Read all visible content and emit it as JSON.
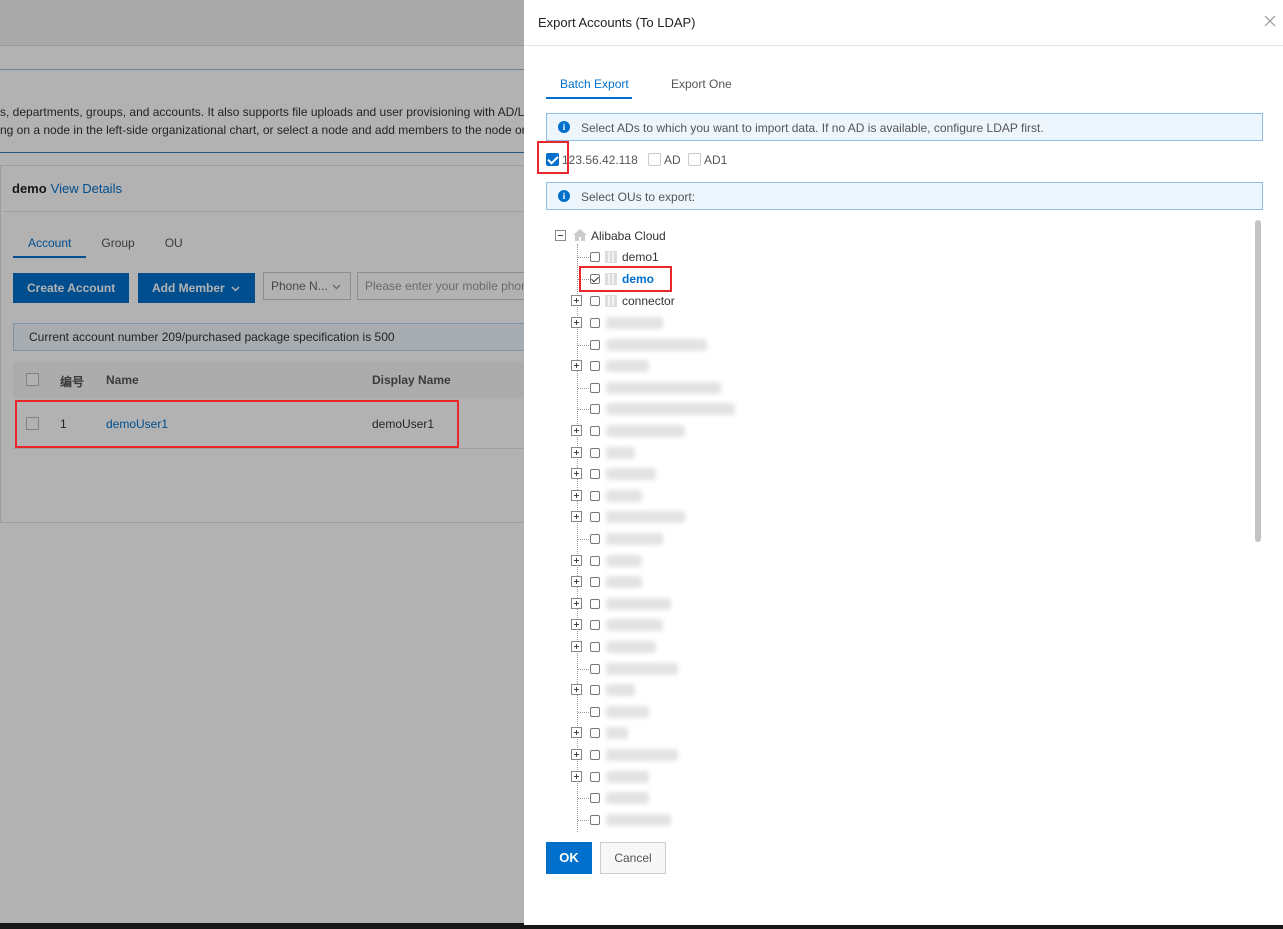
{
  "background": {
    "description_lines": [
      "s, departments, groups, and accounts. It also supports file uploads and user provisioning with AD/LD",
      "ng on a node in the left-side organizational chart, or select a node and add members to the node or"
    ],
    "node_name": "demo",
    "view_details_label": "View Details",
    "tabs": [
      "Account",
      "Group",
      "OU"
    ],
    "create_account_label": "Create Account",
    "add_member_label": "Add Member",
    "phone_select_value": "Phone N...",
    "search_placeholder": "Please enter your mobile phon",
    "account_note": "Current account number 209/purchased package specification is 500",
    "table": {
      "headers": [
        "编号",
        "Name",
        "Display Name"
      ],
      "rows": [
        {
          "id": "1",
          "name": "demoUser1",
          "display_name": "demoUser1"
        }
      ]
    }
  },
  "modal": {
    "title": "Export Accounts (To LDAP)",
    "tabs": [
      "Batch Export",
      "Export One"
    ],
    "active_tab": "Batch Export",
    "ad_note": "Select ADs to which you want to import data. If no AD is available, configure LDAP first.",
    "ad_options": [
      {
        "label": "123.56.42.118",
        "checked": true
      },
      {
        "label": "AD",
        "checked": false
      },
      {
        "label": "AD1",
        "checked": false
      }
    ],
    "ou_note": "Select OUs to export:",
    "tree": {
      "root_label": "Alibaba Cloud",
      "children": [
        {
          "label": "demo1",
          "expandable": false,
          "checked": false
        },
        {
          "label": "demo",
          "expandable": false,
          "checked": true,
          "selected": true
        },
        {
          "label": "connector",
          "expandable": true,
          "checked": false
        }
      ],
      "obscured_rows": [
        {
          "expandable": true,
          "blur": 0.08
        },
        {
          "expandable": false,
          "blur": 0.14
        },
        {
          "expandable": true,
          "blur": 0.06
        },
        {
          "expandable": false,
          "blur": 0.16
        },
        {
          "expandable": false,
          "blur": 0.18
        },
        {
          "expandable": true,
          "blur": 0.11
        },
        {
          "expandable": true,
          "blur": 0.04
        },
        {
          "expandable": true,
          "blur": 0.07
        },
        {
          "expandable": true,
          "blur": 0.05
        },
        {
          "expandable": true,
          "blur": 0.11
        },
        {
          "expandable": false,
          "blur": 0.08
        },
        {
          "expandable": true,
          "blur": 0.05
        },
        {
          "expandable": true,
          "blur": 0.05
        },
        {
          "expandable": true,
          "blur": 0.09
        },
        {
          "expandable": true,
          "blur": 0.08
        },
        {
          "expandable": true,
          "blur": 0.07
        },
        {
          "expandable": false,
          "blur": 0.1
        },
        {
          "expandable": true,
          "blur": 0.04
        },
        {
          "expandable": false,
          "blur": 0.06
        },
        {
          "expandable": true,
          "blur": 0.03
        },
        {
          "expandable": true,
          "blur": 0.1
        },
        {
          "expandable": true,
          "blur": 0.06
        },
        {
          "expandable": false,
          "blur": 0.06
        },
        {
          "expandable": false,
          "blur": 0.09
        },
        {
          "expandable": false,
          "blur": 0.05
        }
      ]
    },
    "ok_label": "OK",
    "cancel_label": "Cancel"
  },
  "colors": {
    "accent": "#0070cc",
    "highlight": "#e8262b",
    "info_bg": "#eef6fd"
  }
}
